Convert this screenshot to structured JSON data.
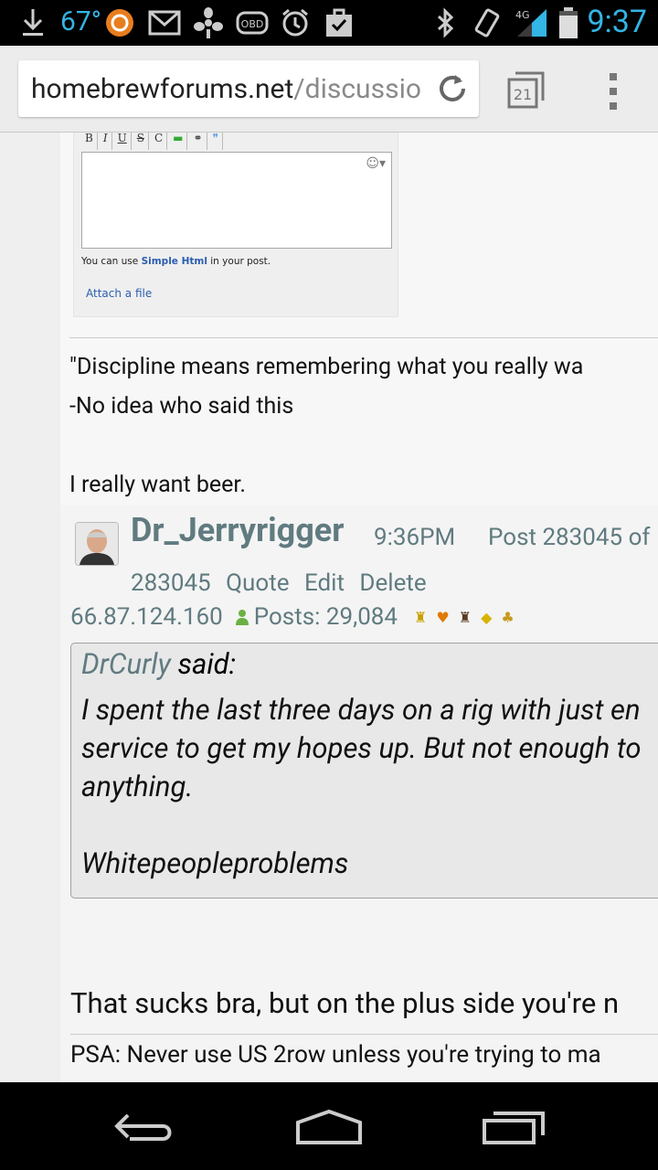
{
  "status_bar": {
    "temperature": "67°",
    "network": "4G",
    "time": "9:37",
    "icons": [
      "download-icon",
      "audio-app-icon",
      "gmail-icon",
      "fan-app-icon",
      "obd-icon",
      "alarm-icon",
      "task-icon",
      "bluetooth-icon",
      "vibrate-icon",
      "signal-icon",
      "battery-icon"
    ]
  },
  "browser": {
    "url_domain": "homebrewforums.net",
    "url_path": "/discussio",
    "tab_count": "21"
  },
  "embedded_editor": {
    "toolbar": [
      "B",
      "I",
      "U",
      "S",
      "C"
    ],
    "hint_prefix": "You can use",
    "hint_link": "Simple Html",
    "hint_suffix": "in your post.",
    "attach_label": "Attach a file"
  },
  "signature1": {
    "line1": "\"Discipline means remembering what you really wa",
    "line2": "-No idea who said this",
    "line3": "I really want beer."
  },
  "post": {
    "author": "Dr_Jerryrigger",
    "time": "9:36PM",
    "post_label": "Post 283045 of",
    "post_id": "283045",
    "quote_label": "Quote",
    "edit_label": "Edit",
    "delete_label": "Delete",
    "ip": "66.87.124.160",
    "posts_label": "Posts: 29,084",
    "quote": {
      "author": "DrCurly",
      "said_label": "said:",
      "line1": "I spent the last three days on a rig with just en",
      "line2": "service to get my hopes up. But not enough to",
      "line3": "anything.",
      "line4": "Whitepeopleproblems"
    },
    "reply_text": "That sucks bra, but on the plus side you're n",
    "signature": "PSA: Never use US 2row unless you're trying to ma"
  },
  "colors": {
    "accent": "#33b5e5",
    "username": "#607b80",
    "link": "#2a5db0"
  }
}
